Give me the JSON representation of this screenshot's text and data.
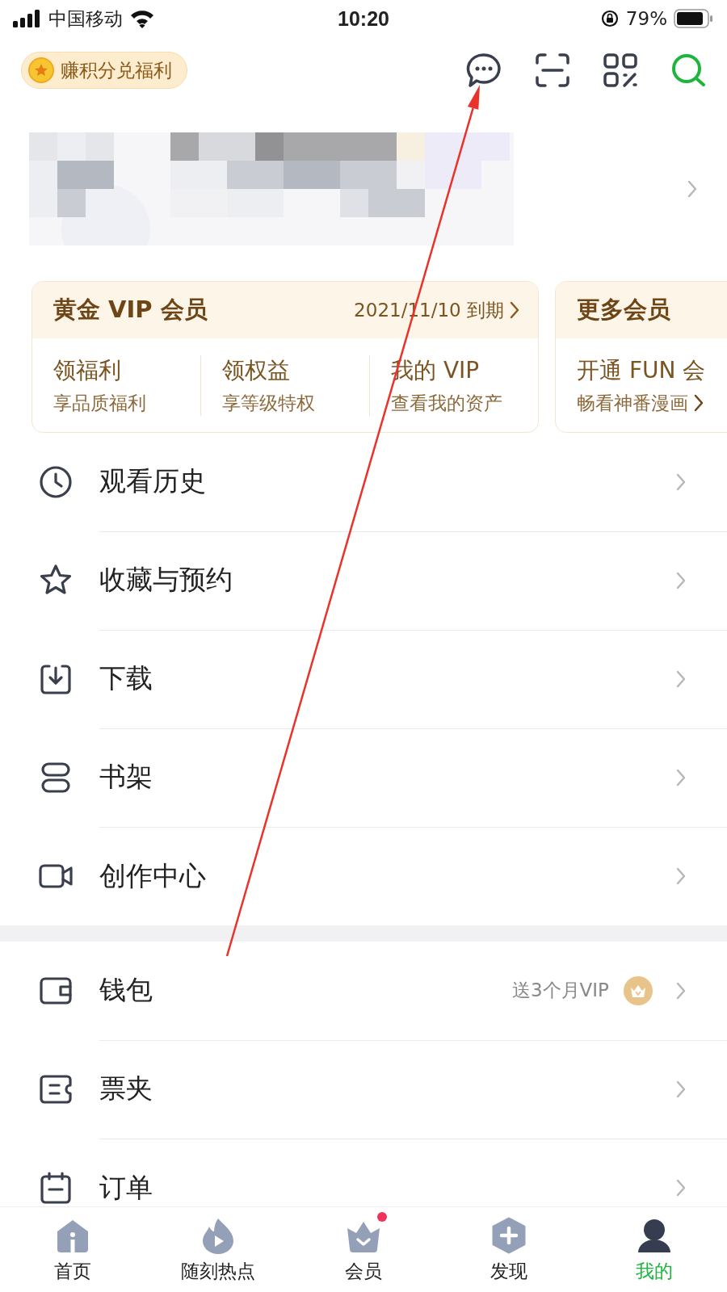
{
  "status_bar": {
    "carrier": "中国移动",
    "time": "10:20",
    "battery": "79%"
  },
  "header": {
    "points_button": "赚积分兑福利"
  },
  "vip_cards": [
    {
      "title": "黄金 VIP 会员",
      "expiry": "2021/11/10 到期",
      "items": [
        {
          "title": "领福利",
          "subtitle": "享品质福利"
        },
        {
          "title": "领权益",
          "subtitle": "享等级特权"
        },
        {
          "title": "我的 VIP",
          "subtitle": "查看我的资产"
        }
      ]
    },
    {
      "title": "更多会员",
      "items": [
        {
          "title": "开通 FUN 会",
          "subtitle": "畅看神番漫画"
        }
      ]
    }
  ],
  "menu_sections": [
    [
      {
        "label": "观看历史",
        "kind": "clock"
      },
      {
        "label": "收藏与预约",
        "kind": "star"
      },
      {
        "label": "下载",
        "kind": "download"
      },
      {
        "label": "书架",
        "kind": "shelf"
      },
      {
        "label": "创作中心",
        "kind": "camera"
      }
    ],
    [
      {
        "label": "钱包",
        "kind": "wallet",
        "promo": "送3个月VIP"
      },
      {
        "label": "票夹",
        "kind": "ticket"
      },
      {
        "label": "订单",
        "kind": "calendar"
      }
    ]
  ],
  "bottom_nav": [
    {
      "label": "首页",
      "kind": "home",
      "selected": false,
      "dot": false
    },
    {
      "label": "随刻热点",
      "kind": "flame",
      "selected": false,
      "dot": false
    },
    {
      "label": "会员",
      "kind": "crown",
      "selected": false,
      "dot": true
    },
    {
      "label": "发现",
      "kind": "plus",
      "selected": false,
      "dot": false
    },
    {
      "label": "我的",
      "kind": "user",
      "selected": true,
      "dot": false
    }
  ]
}
